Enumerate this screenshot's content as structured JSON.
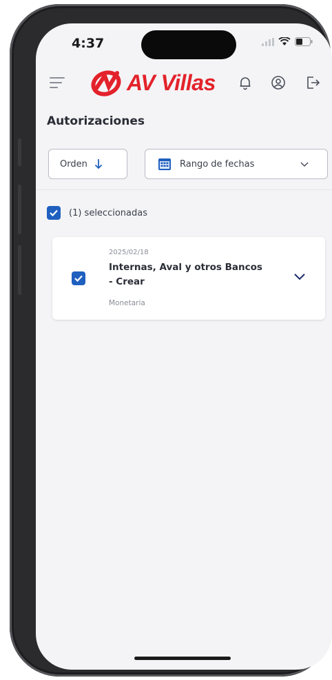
{
  "status_bar": {
    "time": "4:37"
  },
  "header": {
    "brand": "AV Villas"
  },
  "page": {
    "title": "Autorizaciones"
  },
  "filters": {
    "order_label": "Orden",
    "date_range_label": "Rango de fechas"
  },
  "selection": {
    "summary": "(1) seleccionadas",
    "all_checked": true
  },
  "authorizations": [
    {
      "date": "2025/02/18",
      "title": "Internas, Aval y otros Bancos - Crear",
      "type": "Monetaria",
      "checked": true
    }
  ],
  "colors": {
    "brand_red": "#e3222b",
    "checkbox_blue": "#1f5fbf",
    "chevron_navy": "#1c2a6b"
  },
  "icons": [
    "menu-icon",
    "bell-icon",
    "user-circle-icon",
    "logout-icon",
    "arrow-down-icon",
    "calendar-icon",
    "chevron-down-icon",
    "checkbox-checked-icon"
  ]
}
